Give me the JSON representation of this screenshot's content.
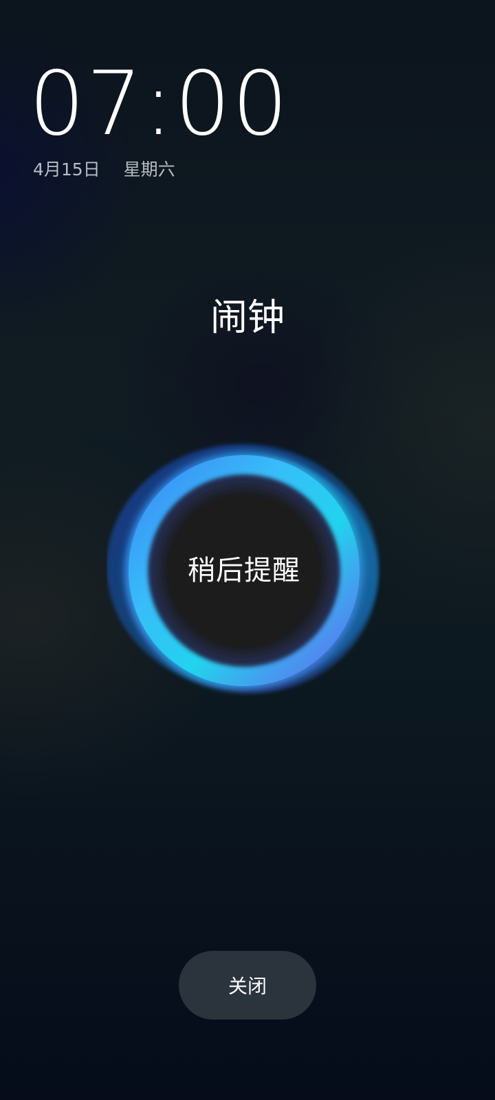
{
  "clock": {
    "time": "07:00",
    "date": "4月15日",
    "weekday": "星期六"
  },
  "alarm": {
    "title": "闹钟",
    "snooze_label": "稍后提醒",
    "close_label": "关闭"
  },
  "colors": {
    "ring_cyan": "#22d3ee",
    "ring_blue": "#2563eb",
    "ring_violet": "#5b3ff0",
    "center": "#1c1c1c",
    "close_button_bg": "#2b333d"
  }
}
